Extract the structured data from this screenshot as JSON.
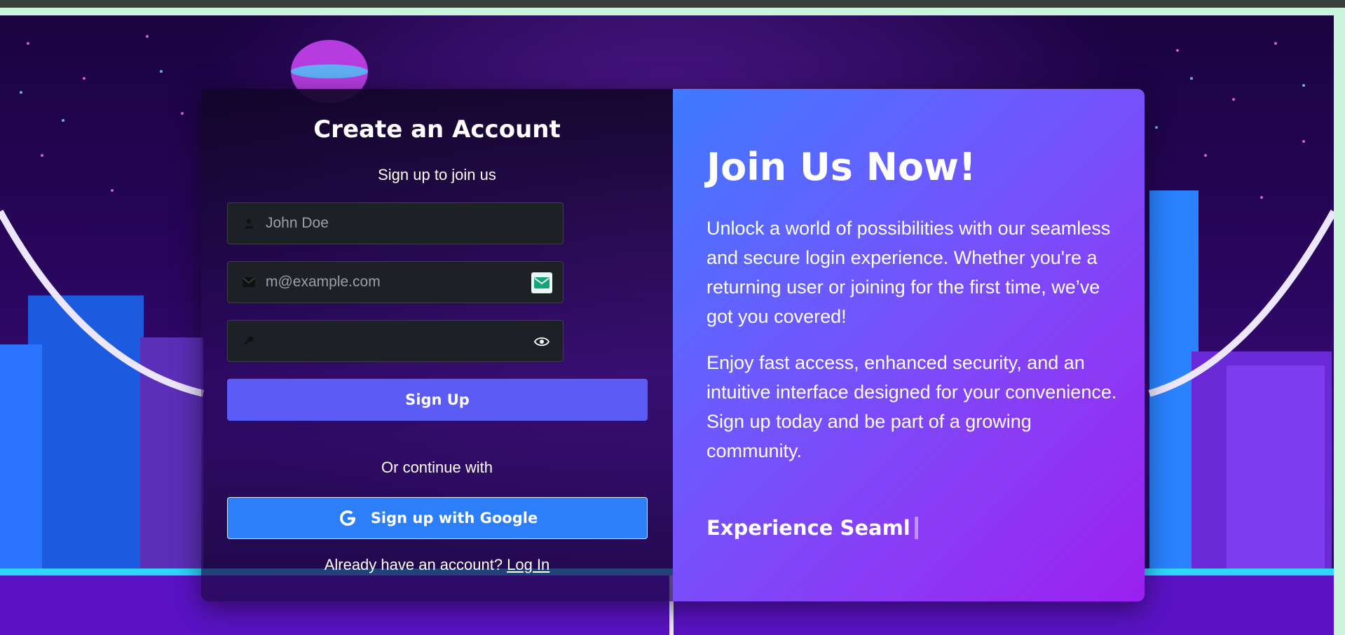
{
  "signup": {
    "title": "Create an Account",
    "subtitle": "Sign up to join us",
    "name_placeholder": "John Doe",
    "email_placeholder": "m@example.com",
    "password_placeholder": "",
    "submit_label": "Sign Up",
    "divider_text": "Or continue with",
    "google_label": "Sign up with Google",
    "login_prompt": "Already have an account?",
    "login_link": "Log In"
  },
  "promo": {
    "title": "Join Us Now!",
    "paragraph_1": "Unlock a world of possibilities with our seamless and secure login experience. Whether you're a returning user or joining for the first time, we’ve got you covered!",
    "paragraph_2": "Enjoy fast access, enhanced security, and an intuitive interface designed for your convenience. Sign up today and be part of a growing community.",
    "typing_text": "Experience Seaml"
  },
  "icons": {
    "name_field": "user-icon",
    "email_field": "envelope-icon",
    "email_extension": "temp-mail-icon",
    "password_field": "key-icon",
    "password_toggle": "eye-icon",
    "google": "google-icon"
  },
  "colors": {
    "primary_button": "#5b5cf6",
    "google_button": "#2d7ff9",
    "panel_gradient_start": "#3d7bff",
    "panel_gradient_end": "#9b20f0"
  }
}
